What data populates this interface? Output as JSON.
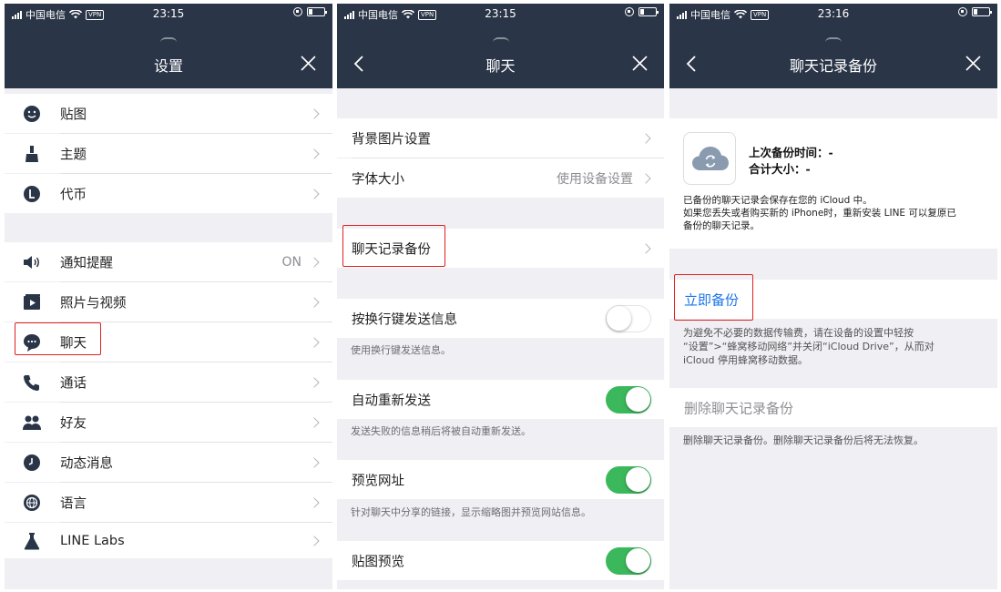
{
  "status": {
    "carrier": "中国电信",
    "vpn": "VPN",
    "time_1": "23:15",
    "time_2": "23:15",
    "time_3": "23:16"
  },
  "screen1": {
    "title": "设置",
    "items": [
      {
        "label": "贴图",
        "icon": "sticker-icon"
      },
      {
        "label": "主题",
        "icon": "brush-icon"
      },
      {
        "label": "代币",
        "icon": "coin-icon"
      },
      {
        "label": "通知提醒",
        "value": "ON",
        "icon": "speaker-icon"
      },
      {
        "label": "照片与视频",
        "icon": "photo-video-icon"
      },
      {
        "label": "聊天",
        "icon": "chat-bubble-icon"
      },
      {
        "label": "通话",
        "icon": "phone-icon"
      },
      {
        "label": "好友",
        "icon": "friends-icon"
      },
      {
        "label": "动态消息",
        "icon": "clock-icon"
      },
      {
        "label": "语言",
        "icon": "globe-icon"
      },
      {
        "label": "LINE Labs",
        "icon": "flask-icon"
      }
    ]
  },
  "screen2": {
    "title": "聊天",
    "bg_label": "背景图片设置",
    "font_label": "字体大小",
    "font_value": "使用设备设置",
    "backup_label": "聊天记录备份",
    "enter_label": "按换行键发送信息",
    "enter_note": "使用换行键发送信息。",
    "resend_label": "自动重新发送",
    "resend_note": "发送失败的信息稍后将被自动重新发送。",
    "preview_label": "预览网址",
    "preview_note": "针对聊天中分享的链接，显示缩略图并预览网站信息。",
    "sticker_preview_label": "贴图预览",
    "toggles": {
      "enter_key": false,
      "auto_resend": true,
      "url_preview": true,
      "sticker_preview": true
    }
  },
  "screen3": {
    "title": "聊天记录备份",
    "last_backup_label": "上次备份时间：",
    "last_backup_value": "-",
    "total_size_label": "合计大小：",
    "total_size_value": "-",
    "info_line1": "已备份的聊天记录会保存在您的 iCloud 中。",
    "info_line2": "如果您丢失或者购买新的 iPhone时，重新安装 LINE 可以复原已",
    "info_line3": "备份的聊天记录。",
    "backup_now": "立即备份",
    "warn_line1": "为避免不必要的数据传输费，请在设备的设置中轻按",
    "warn_line2": "“设置”>“蜂窝移动网络”并关闭“iCloud Drive”，从而对",
    "warn_line3": "iCloud 停用蜂窝移动数据。",
    "delete_label": "删除聊天记录备份",
    "delete_note": "删除聊天记录备份。删除聊天记录备份后将无法恢复。"
  },
  "colors": {
    "navbar": "#2a3547",
    "accent_blue": "#1a74e8",
    "toggle_on": "#3bb85b",
    "highlight": "#e02020"
  }
}
